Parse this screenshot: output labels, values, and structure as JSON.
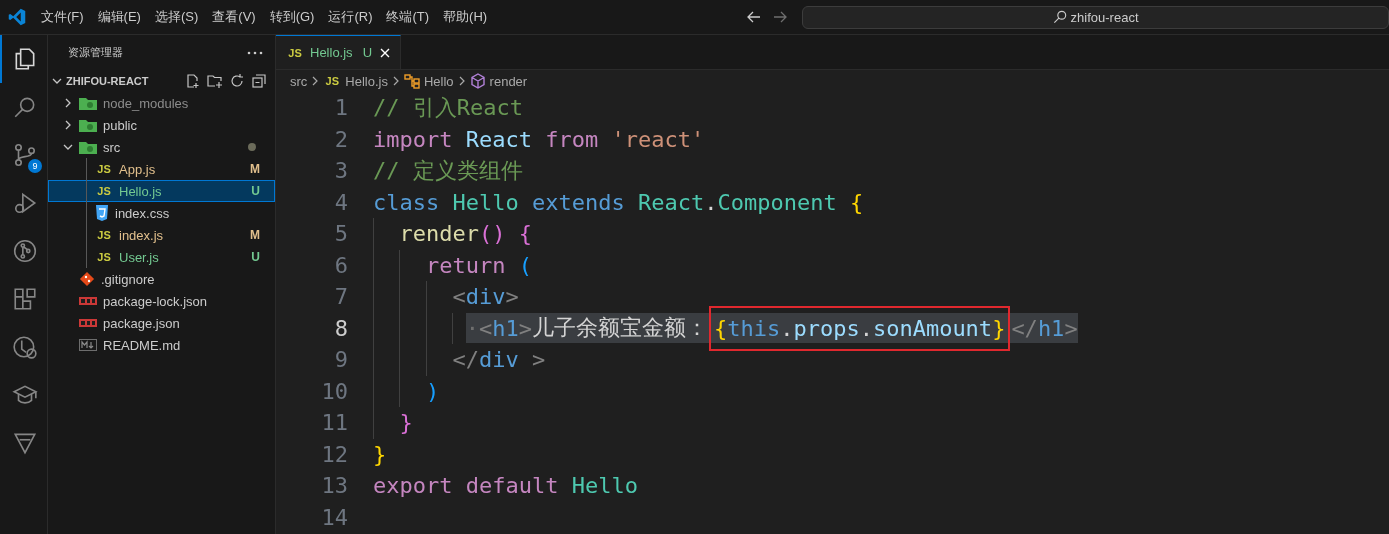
{
  "menu": [
    "文件(F)",
    "编辑(E)",
    "选择(S)",
    "查看(V)",
    "转到(G)",
    "运行(R)",
    "终端(T)",
    "帮助(H)"
  ],
  "search": {
    "value": "zhifou-react"
  },
  "activity_bar": [
    {
      "selected": true
    },
    {
      "selected": false
    },
    {
      "selected": false,
      "badge": "9"
    },
    {
      "selected": false
    },
    {
      "selected": false
    },
    {
      "selected": false
    },
    {
      "selected": false
    },
    {
      "selected": false
    },
    {
      "selected": false
    }
  ],
  "sidebar": {
    "title": "资源管理器",
    "section": "ZHIFOU-REACT",
    "tree": [
      {
        "label": "node_modules",
        "kind": "folder",
        "expanded": false,
        "ignored": true,
        "selected": false
      },
      {
        "label": "public",
        "kind": "folder",
        "expanded": false,
        "ignored": false,
        "selected": false
      },
      {
        "label": "src",
        "kind": "folder",
        "expanded": true,
        "ignored": false,
        "selected": false,
        "has_changes": true,
        "children": [
          {
            "label": "App.js",
            "kind": "js",
            "icon_label": "JS",
            "status": "M",
            "color": "#e2c08d",
            "selected": false
          },
          {
            "label": "Hello.js",
            "kind": "js",
            "icon_label": "JS",
            "status": "U",
            "color": "#73c991",
            "selected": true
          },
          {
            "label": "index.css",
            "kind": "css",
            "selected": false
          },
          {
            "label": "index.js",
            "kind": "js",
            "icon_label": "JS",
            "status": "M",
            "color": "#e2c08d",
            "selected": false
          },
          {
            "label": "User.js",
            "kind": "js",
            "icon_label": "JS",
            "status": "U",
            "color": "#73c991",
            "selected": false
          }
        ]
      },
      {
        "label": ".gitignore",
        "kind": "git",
        "selected": false
      },
      {
        "label": "package-lock.json",
        "kind": "npm",
        "selected": false
      },
      {
        "label": "package.json",
        "kind": "npm",
        "selected": false
      },
      {
        "label": "README.md",
        "kind": "md",
        "selected": false
      }
    ]
  },
  "tabs": [
    {
      "label": "Hello.js",
      "icon_label": "JS",
      "status": "U",
      "color": "#73c991",
      "selected": true
    }
  ],
  "breadcrumb": [
    {
      "text": "src",
      "kind": "folder"
    },
    {
      "text": "Hello.js",
      "kind": "js",
      "icon_label": "JS"
    },
    {
      "text": "Hello",
      "kind": "class"
    },
    {
      "text": "render",
      "kind": "method"
    }
  ],
  "code": [
    {
      "number": "1",
      "selected": false,
      "tokens": [
        {
          "text": "// 引入React",
          "kind": "comment"
        }
      ]
    },
    {
      "number": "2",
      "selected": false,
      "tokens": [
        {
          "text": "import ",
          "kind": "control"
        },
        {
          "text": "React ",
          "kind": "variable"
        },
        {
          "text": "from ",
          "kind": "control"
        },
        {
          "text": "'react'",
          "kind": "string"
        }
      ]
    },
    {
      "number": "3",
      "selected": false,
      "tokens": [
        {
          "text": "// 定义类组件",
          "kind": "comment"
        }
      ]
    },
    {
      "number": "4",
      "selected": false,
      "tokens": [
        {
          "text": "class ",
          "kind": "storage"
        },
        {
          "text": "Hello ",
          "kind": "type"
        },
        {
          "text": "extends ",
          "kind": "storage"
        },
        {
          "text": "React",
          "kind": "type"
        },
        {
          "text": ".",
          "kind": "plain"
        },
        {
          "text": "Component ",
          "kind": "type"
        },
        {
          "text": "{",
          "kind": "bracket1"
        }
      ]
    },
    {
      "number": "5",
      "selected": false,
      "tokens": [
        {
          "text": "  render",
          "kind": "function"
        },
        {
          "text": "() {",
          "kind": "bracket2"
        }
      ]
    },
    {
      "number": "6",
      "selected": false,
      "tokens": [
        {
          "text": "    return ",
          "kind": "control"
        },
        {
          "text": "(",
          "kind": "bracket3"
        }
      ]
    },
    {
      "number": "7",
      "selected": false,
      "tokens": [
        {
          "text": "      <",
          "kind": "tag_punct"
        },
        {
          "text": "div",
          "kind": "tag"
        },
        {
          "text": ">",
          "kind": "tag_punct"
        }
      ]
    },
    {
      "number": "8",
      "selected": true,
      "tokens": [
        {
          "text": "       ·",
          "kind": "space_mark"
        },
        {
          "text": "<",
          "kind": "tag_punct"
        },
        {
          "text": "h1",
          "kind": "tag"
        },
        {
          "text": ">",
          "kind": "tag_punct"
        },
        {
          "text": "儿子余额宝金额：",
          "kind": "plain"
        },
        {
          "kind": "group",
          "boxed": true,
          "tokens": [
            {
              "text": "{",
              "kind": "bracket1"
            },
            {
              "text": "this",
              "kind": "storage"
            },
            {
              "text": ".",
              "kind": "plain"
            },
            {
              "text": "props",
              "kind": "variable"
            },
            {
              "text": ".",
              "kind": "plain"
            },
            {
              "text": "sonAmount",
              "kind": "variable"
            },
            {
              "text": "}",
              "kind": "bracket1"
            }
          ]
        },
        {
          "text": "</",
          "kind": "tag_punct"
        },
        {
          "text": "h1",
          "kind": "tag"
        },
        {
          "text": ">",
          "kind": "tag_punct"
        }
      ]
    },
    {
      "number": "9",
      "selected": false,
      "tokens": [
        {
          "text": "      </",
          "kind": "tag_punct"
        },
        {
          "text": "div",
          "kind": "tag"
        },
        {
          "text": " >",
          "kind": "tag_punct"
        }
      ]
    },
    {
      "number": "10",
      "selected": false,
      "tokens": [
        {
          "text": "    )",
          "kind": "bracket3"
        }
      ]
    },
    {
      "number": "11",
      "selected": false,
      "tokens": [
        {
          "text": "  }",
          "kind": "bracket2"
        }
      ]
    },
    {
      "number": "12",
      "selected": false,
      "tokens": [
        {
          "text": "}",
          "kind": "bracket1"
        }
      ]
    },
    {
      "number": "13",
      "selected": false,
      "tokens": [
        {
          "text": "export default ",
          "kind": "control"
        },
        {
          "text": "Hello",
          "kind": "type"
        }
      ]
    },
    {
      "number": "14",
      "selected": false
    }
  ]
}
